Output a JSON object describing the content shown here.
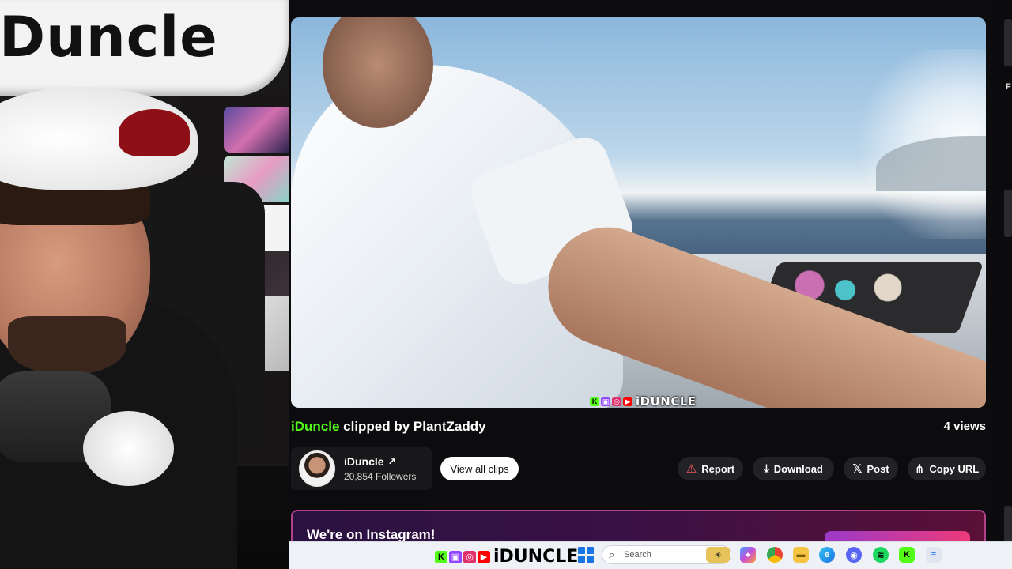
{
  "webcam": {
    "skateboard_text": "iDuncle"
  },
  "video": {
    "watermark_text": "iDUNCLE",
    "watermark_badges": [
      "K",
      "▣",
      "◎",
      "▶"
    ]
  },
  "clip": {
    "streamer": "iDuncle",
    "clipped_by_text": "clipped by PlantZaddy",
    "views": "4 views"
  },
  "channel": {
    "name": "iDuncle",
    "followers": "20,854 Followers",
    "view_all_label": "View all clips"
  },
  "actions": {
    "report": "Report",
    "download": "Download",
    "post": "Post",
    "copy_url": "Copy URL"
  },
  "banner": {
    "title": "We're on Instagram!"
  },
  "right_panel": {
    "partial_label": "F"
  },
  "taskbar": {
    "logo_text": "iDUNCLE",
    "search_placeholder": "Search",
    "icons": [
      "start-icon",
      "search-icon",
      "widgets-icon",
      "copilot-icon",
      "chrome-icon",
      "file-explorer-icon",
      "edge-icon",
      "discord-icon",
      "spotify-icon",
      "kick-icon",
      "notepad-icon"
    ]
  },
  "colors": {
    "kick_green": "#53fc18",
    "report_red": "#ff5a5a",
    "banner_border": "#b2418a"
  }
}
